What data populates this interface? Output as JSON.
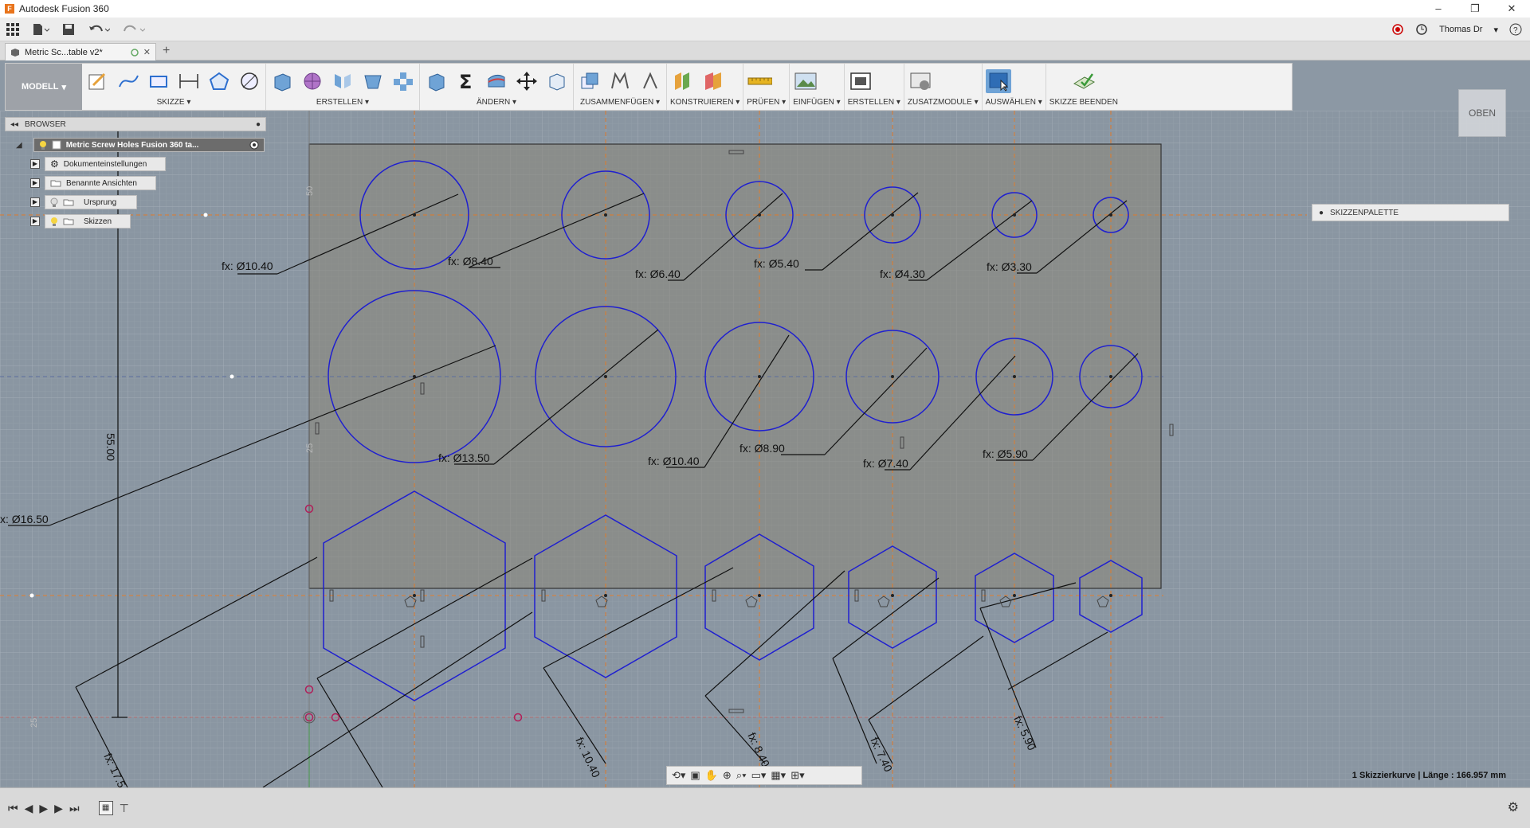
{
  "app": {
    "title": "Autodesk Fusion 360"
  },
  "window_controls": {
    "minimize": "–",
    "restore": "❐",
    "close": "✕"
  },
  "quick_access": {
    "user": "Thomas Dr",
    "help": "?"
  },
  "tab": {
    "label": "Metric Sc...table v2*"
  },
  "toolbar": {
    "workspace": "MODELL",
    "groups": [
      {
        "label": "SKIZZE"
      },
      {
        "label": "ERSTELLEN"
      },
      {
        "label": "ÄNDERN"
      },
      {
        "label": "ZUSAMMENFÜGEN"
      },
      {
        "label": "KONSTRUIEREN"
      },
      {
        "label": "PRÜFEN"
      },
      {
        "label": "EINFÜGEN"
      },
      {
        "label": "ERSTELLEN"
      },
      {
        "label": "ZUSATZMODULE"
      },
      {
        "label": "AUSWÄHLEN"
      },
      {
        "label": "SKIZZE BEENDEN"
      }
    ]
  },
  "browser": {
    "header": "BROWSER",
    "root": "Metric Screw Holes Fusion 360 ta...",
    "items": [
      "Dokumenteinstellungen",
      "Benannte Ansichten",
      "Ursprung",
      "Skizzen"
    ]
  },
  "palette": {
    "label": "SKIZZENPALETTE"
  },
  "viewcube": {
    "label": "OBEN"
  },
  "status": {
    "text": "1 Skizzierkurve | Länge : 166.957 mm"
  },
  "sketch": {
    "dims_row1": [
      "fx: Ø10.40",
      "fx: Ø8.40",
      "fx: Ø6.40",
      "fx: Ø5.40",
      "fx: Ø4.30",
      "fx: Ø3.30"
    ],
    "dims_row2": [
      "fx: Ø13.50",
      "fx: Ø10.40",
      "fx: Ø8.90",
      "fx: Ø7.40",
      "fx: Ø5.90"
    ],
    "dim_left": "x: Ø16.50",
    "dim_vertical": "55.00",
    "dims_hex": [
      "fx: 17.5",
      "fx: 10.40",
      "fx: 8.40",
      "fx: 7.40",
      "fx: 5.90"
    ],
    "small_labels": [
      "50",
      "25",
      "25"
    ]
  }
}
